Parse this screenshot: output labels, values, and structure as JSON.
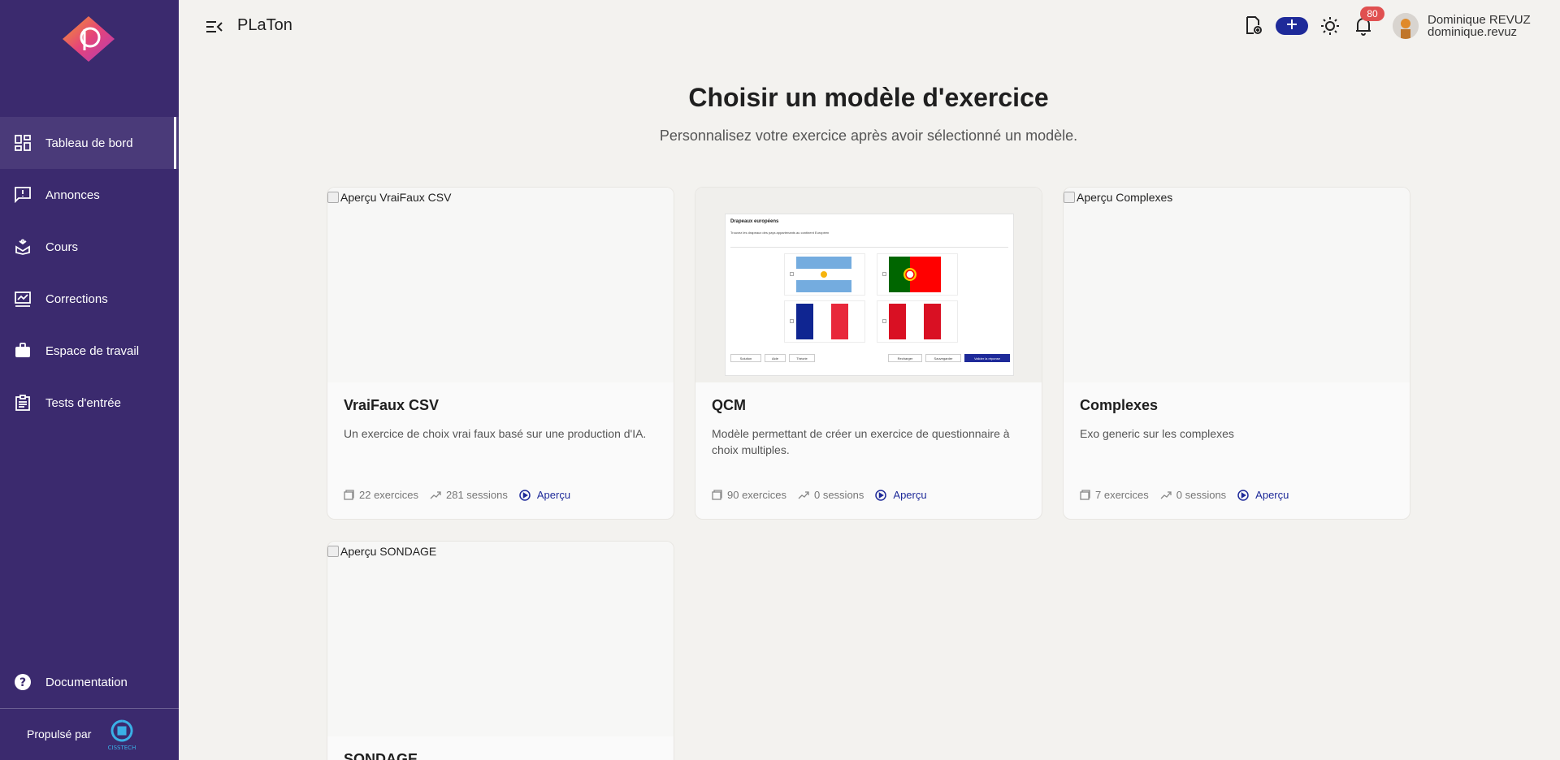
{
  "app": {
    "title": "PLaTon"
  },
  "sidebar": {
    "items": [
      {
        "label": "Tableau de bord",
        "icon": "dashboard-icon",
        "active": true
      },
      {
        "label": "Annonces",
        "icon": "announcement-icon"
      },
      {
        "label": "Cours",
        "icon": "course-icon"
      },
      {
        "label": "Corrections",
        "icon": "corrections-icon"
      },
      {
        "label": "Espace de travail",
        "icon": "briefcase-icon"
      },
      {
        "label": "Tests d'entrée",
        "icon": "clipboard-icon"
      }
    ],
    "documentation": "Documentation",
    "powered_by": "Propulsé par",
    "powered_by_brand": "CISSTECH"
  },
  "topbar": {
    "notifications_count": "80",
    "user": {
      "name": "Dominique REVUZ",
      "login": "dominique.revuz"
    }
  },
  "page": {
    "title": "Choisir un modèle d'exercice",
    "subtitle": "Personnalisez votre exercice après avoir sélectionné un modèle."
  },
  "cards": [
    {
      "image_alt": "Aperçu VraiFaux CSV",
      "title": "VraiFaux CSV",
      "description": "Un exercice de choix vrai faux basé sur une production d'IA.",
      "exercises": "22 exercices",
      "sessions": "281 sessions",
      "preview": "Aperçu"
    },
    {
      "image_alt": "Aperçu QCM",
      "title": "QCM",
      "description": "Modèle permettant de créer un exercice de questionnaire à choix multiples.",
      "exercises": "90 exercices",
      "sessions": "0 sessions",
      "preview": "Aperçu",
      "preview_shot": {
        "title": "Drapeaux européens",
        "subtitle": "Trouvez les drapeaux des pays appartenants au continent Européen",
        "buttons": [
          "Solution",
          "Aide",
          "Théorie",
          "Recharger",
          "Sauvegarder",
          "Valider la réponse"
        ]
      }
    },
    {
      "image_alt": "Aperçu Complexes",
      "title": "Complexes",
      "description": "Exo generic sur les complexes",
      "exercises": "7 exercices",
      "sessions": "0 sessions",
      "preview": "Aperçu"
    },
    {
      "image_alt": "Aperçu SONDAGE",
      "title": "SONDAGE"
    }
  ],
  "colors": {
    "sidebar": "#3b2a6e",
    "accent": "#1e2a99",
    "background": "#f3f2ef",
    "badge": "#e05050"
  }
}
